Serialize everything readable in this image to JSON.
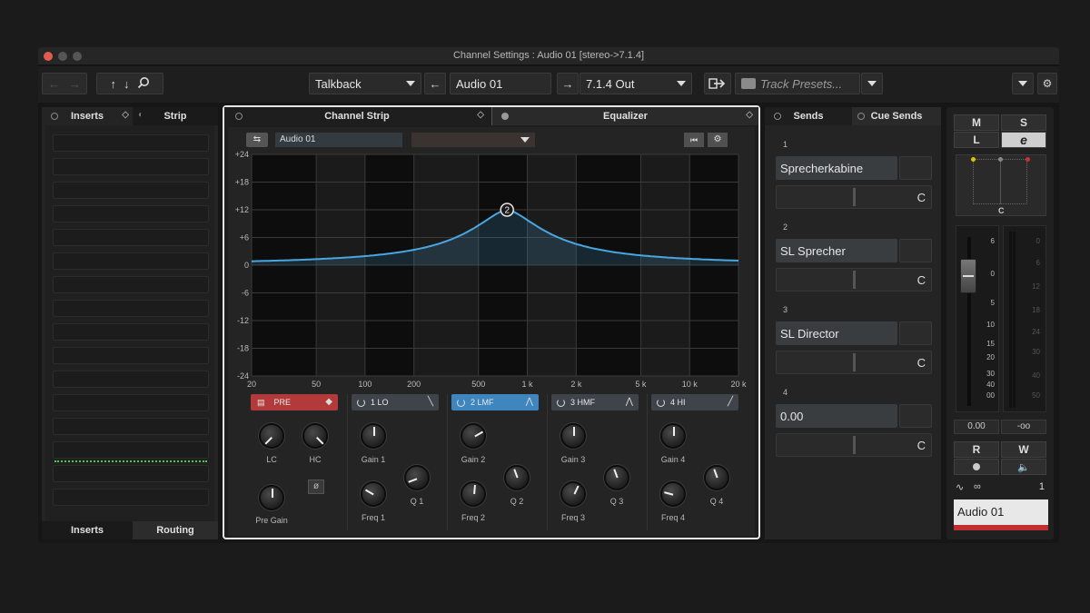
{
  "window": {
    "title": "Channel Settings : Audio 01 [stereo->7.1.4]"
  },
  "toolbar": {
    "input_routing": "Talkback",
    "channel_name": "Audio 01",
    "output_routing": "7.1.4 Out",
    "track_presets_placeholder": "Track Presets..."
  },
  "left_panel": {
    "tabs": [
      "Inserts",
      "Strip"
    ],
    "bottom_tabs": [
      "Inserts",
      "Routing"
    ]
  },
  "center_tabs": [
    "Channel Strip",
    "Equalizer"
  ],
  "eq": {
    "preset_name": "Audio 01",
    "y_ticks": [
      "+24",
      "+18",
      "+12",
      "+6",
      "0",
      "-6",
      "-12",
      "-18",
      "-24"
    ],
    "x_ticks": [
      "20",
      "50",
      "100",
      "200",
      "500",
      "1 k",
      "2 k",
      "5 k",
      "10 k",
      "20 k"
    ],
    "active_node": "2",
    "colors": {
      "curve": "#4aa6e0",
      "active_band": "#3f86bf",
      "pre": "#b33a3a"
    },
    "pre": {
      "label": "PRE",
      "lc_label": "LC",
      "hc_label": "HC",
      "pregain_label": "Pre Gain"
    },
    "bands": [
      {
        "label": "1 LO",
        "gain_label": "Gain 1",
        "freq_label": "Freq 1",
        "q_label": "Q 1",
        "active": false
      },
      {
        "label": "2 LMF",
        "gain_label": "Gain 2",
        "freq_label": "Freq 2",
        "q_label": "Q 2",
        "active": true
      },
      {
        "label": "3 HMF",
        "gain_label": "Gain 3",
        "freq_label": "Freq 3",
        "q_label": "Q 3",
        "active": false
      },
      {
        "label": "4 HI",
        "gain_label": "Gain 4",
        "freq_label": "Freq 4",
        "q_label": "Q 4",
        "active": false
      }
    ]
  },
  "sends": {
    "tabs": [
      "Sends",
      "Cue Sends"
    ],
    "items": [
      {
        "num": "1",
        "name": "Sprecherkabine",
        "pan": "C"
      },
      {
        "num": "2",
        "name": "SL Sprecher",
        "pan": "C"
      },
      {
        "num": "3",
        "name": "SL Director",
        "pan": "C"
      },
      {
        "num": "4",
        "name": "0.00",
        "pan": "C"
      }
    ]
  },
  "mixer": {
    "m": "M",
    "s": "S",
    "l": "L",
    "e": "e",
    "pan_label": "C",
    "fader_scale": [
      "6",
      "0",
      "5",
      "10",
      "15",
      "20",
      "30",
      "40",
      "00"
    ],
    "meter_scale": [
      "0",
      "6",
      "12",
      "18",
      "24",
      "30",
      "40",
      "50"
    ],
    "volume": "0.00",
    "peak": "-oo",
    "r": "R",
    "w": "W",
    "channel_number": "1",
    "channel_name": "Audio 01"
  }
}
